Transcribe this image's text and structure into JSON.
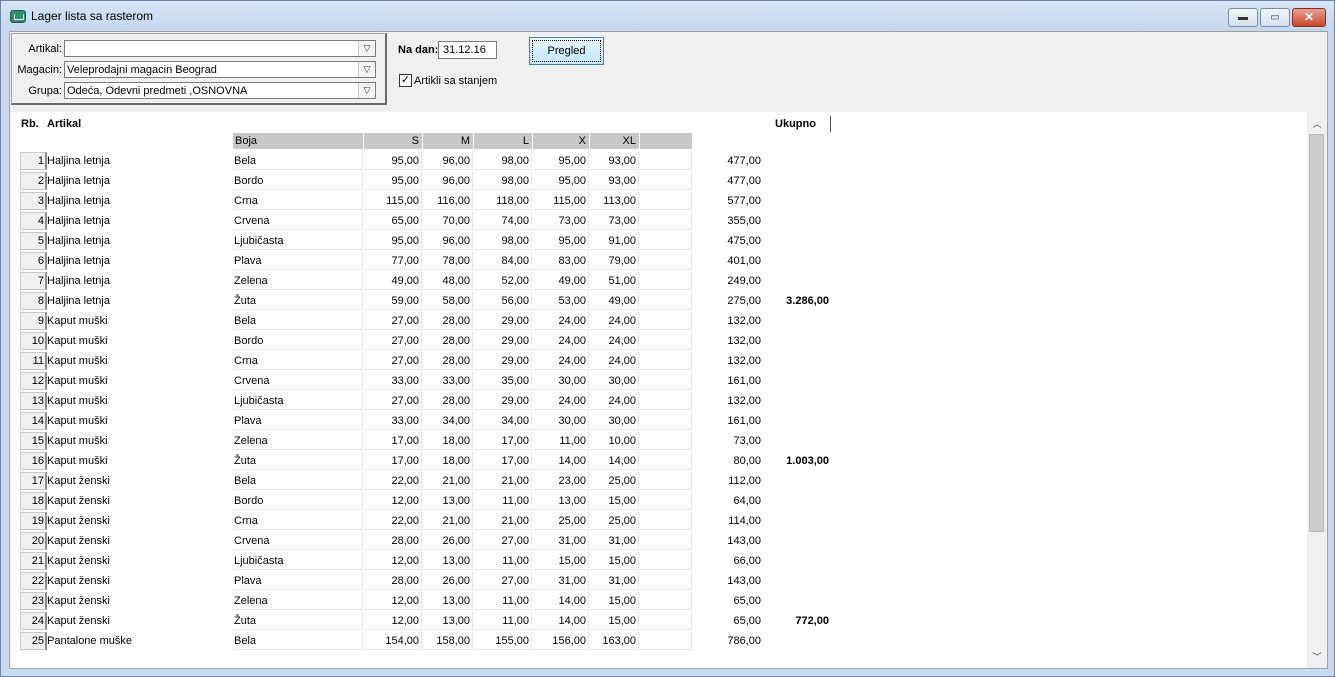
{
  "window": {
    "title": "Lager lista sa rasterom",
    "min_icon": "minimize-icon",
    "max_icon": "maximize-icon",
    "close_icon": "close-icon",
    "min_glyph": "▬",
    "max_glyph": "▭",
    "close_glyph": "✕"
  },
  "filters": {
    "artikal_label": "Artikal:",
    "artikal_value": "",
    "magacin_label": "Magacin:",
    "magacin_value": "Veleprodajni magacin Beograd",
    "grupa_label": "Grupa:",
    "grupa_value": "Odeća, Odevni predmeti ,OSNOVNA",
    "dropdown_glyph": "▽"
  },
  "date": {
    "label": "Na dan:",
    "value": "31.12.16"
  },
  "pregled_label": "Pregled",
  "checkbox": {
    "label": "Artikli sa stanjem",
    "checked_glyph": "✓"
  },
  "grid": {
    "col_rb": "Rb.",
    "col_artikal": "Artikal",
    "col_ukupno": "Ukupno",
    "col_boja": "Boja",
    "sizes": [
      "S",
      "M",
      "L",
      "X",
      "XL"
    ],
    "rows": [
      {
        "rb": "1",
        "artikal": "Haljina letnja",
        "boja": "Bela",
        "v": [
          "95,00",
          "96,00",
          "98,00",
          "95,00",
          "93,00"
        ],
        "total": "477,00",
        "grand": ""
      },
      {
        "rb": "2",
        "artikal": "Haljina letnja",
        "boja": "Bordo",
        "v": [
          "95,00",
          "96,00",
          "98,00",
          "95,00",
          "93,00"
        ],
        "total": "477,00",
        "grand": ""
      },
      {
        "rb": "3",
        "artikal": "Haljina letnja",
        "boja": "Crna",
        "v": [
          "115,00",
          "116,00",
          "118,00",
          "115,00",
          "113,00"
        ],
        "total": "577,00",
        "grand": ""
      },
      {
        "rb": "4",
        "artikal": "Haljina letnja",
        "boja": "Crvena",
        "v": [
          "65,00",
          "70,00",
          "74,00",
          "73,00",
          "73,00"
        ],
        "total": "355,00",
        "grand": ""
      },
      {
        "rb": "5",
        "artikal": "Haljina letnja",
        "boja": "Ljubičasta",
        "v": [
          "95,00",
          "96,00",
          "98,00",
          "95,00",
          "91,00"
        ],
        "total": "475,00",
        "grand": ""
      },
      {
        "rb": "6",
        "artikal": "Haljina letnja",
        "boja": "Plava",
        "v": [
          "77,00",
          "78,00",
          "84,00",
          "83,00",
          "79,00"
        ],
        "total": "401,00",
        "grand": ""
      },
      {
        "rb": "7",
        "artikal": "Haljina letnja",
        "boja": "Zelena",
        "v": [
          "49,00",
          "48,00",
          "52,00",
          "49,00",
          "51,00"
        ],
        "total": "249,00",
        "grand": ""
      },
      {
        "rb": "8",
        "artikal": "Haljina letnja",
        "boja": "Žuta",
        "v": [
          "59,00",
          "58,00",
          "56,00",
          "53,00",
          "49,00"
        ],
        "total": "275,00",
        "grand": "3.286,00"
      },
      {
        "rb": "9",
        "artikal": "Kaput muški",
        "boja": "Bela",
        "v": [
          "27,00",
          "28,00",
          "29,00",
          "24,00",
          "24,00"
        ],
        "total": "132,00",
        "grand": ""
      },
      {
        "rb": "10",
        "artikal": "Kaput muški",
        "boja": "Bordo",
        "v": [
          "27,00",
          "28,00",
          "29,00",
          "24,00",
          "24,00"
        ],
        "total": "132,00",
        "grand": ""
      },
      {
        "rb": "11",
        "artikal": "Kaput muški",
        "boja": "Crna",
        "v": [
          "27,00",
          "28,00",
          "29,00",
          "24,00",
          "24,00"
        ],
        "total": "132,00",
        "grand": ""
      },
      {
        "rb": "12",
        "artikal": "Kaput muški",
        "boja": "Crvena",
        "v": [
          "33,00",
          "33,00",
          "35,00",
          "30,00",
          "30,00"
        ],
        "total": "161,00",
        "grand": ""
      },
      {
        "rb": "13",
        "artikal": "Kaput muški",
        "boja": "Ljubičasta",
        "v": [
          "27,00",
          "28,00",
          "29,00",
          "24,00",
          "24,00"
        ],
        "total": "132,00",
        "grand": ""
      },
      {
        "rb": "14",
        "artikal": "Kaput muški",
        "boja": "Plava",
        "v": [
          "33,00",
          "34,00",
          "34,00",
          "30,00",
          "30,00"
        ],
        "total": "161,00",
        "grand": ""
      },
      {
        "rb": "15",
        "artikal": "Kaput muški",
        "boja": "Zelena",
        "v": [
          "17,00",
          "18,00",
          "17,00",
          "11,00",
          "10,00"
        ],
        "total": "73,00",
        "grand": ""
      },
      {
        "rb": "16",
        "artikal": "Kaput muški",
        "boja": "Žuta",
        "v": [
          "17,00",
          "18,00",
          "17,00",
          "14,00",
          "14,00"
        ],
        "total": "80,00",
        "grand": "1.003,00"
      },
      {
        "rb": "17",
        "artikal": "Kaput ženski",
        "boja": "Bela",
        "v": [
          "22,00",
          "21,00",
          "21,00",
          "23,00",
          "25,00"
        ],
        "total": "112,00",
        "grand": ""
      },
      {
        "rb": "18",
        "artikal": "Kaput ženski",
        "boja": "Bordo",
        "v": [
          "12,00",
          "13,00",
          "11,00",
          "13,00",
          "15,00"
        ],
        "total": "64,00",
        "grand": ""
      },
      {
        "rb": "19",
        "artikal": "Kaput ženski",
        "boja": "Crna",
        "v": [
          "22,00",
          "21,00",
          "21,00",
          "25,00",
          "25,00"
        ],
        "total": "114,00",
        "grand": ""
      },
      {
        "rb": "20",
        "artikal": "Kaput ženski",
        "boja": "Crvena",
        "v": [
          "28,00",
          "26,00",
          "27,00",
          "31,00",
          "31,00"
        ],
        "total": "143,00",
        "grand": ""
      },
      {
        "rb": "21",
        "artikal": "Kaput ženski",
        "boja": "Ljubičasta",
        "v": [
          "12,00",
          "13,00",
          "11,00",
          "15,00",
          "15,00"
        ],
        "total": "66,00",
        "grand": ""
      },
      {
        "rb": "22",
        "artikal": "Kaput ženski",
        "boja": "Plava",
        "v": [
          "28,00",
          "26,00",
          "27,00",
          "31,00",
          "31,00"
        ],
        "total": "143,00",
        "grand": ""
      },
      {
        "rb": "23",
        "artikal": "Kaput ženski",
        "boja": "Zelena",
        "v": [
          "12,00",
          "13,00",
          "11,00",
          "14,00",
          "15,00"
        ],
        "total": "65,00",
        "grand": ""
      },
      {
        "rb": "24",
        "artikal": "Kaput ženski",
        "boja": "Žuta",
        "v": [
          "12,00",
          "13,00",
          "11,00",
          "14,00",
          "15,00"
        ],
        "total": "65,00",
        "grand": "772,00"
      },
      {
        "rb": "25",
        "artikal": "Pantalone muške",
        "boja": "Bela",
        "v": [
          "154,00",
          "158,00",
          "155,00",
          "156,00",
          "163,00"
        ],
        "total": "786,00",
        "grand": ""
      }
    ]
  },
  "scrollbar": {
    "up_icon": "scroll-up-icon",
    "down_icon": "scroll-down-icon",
    "up_glyph": "︿",
    "down_glyph": "﹀"
  }
}
